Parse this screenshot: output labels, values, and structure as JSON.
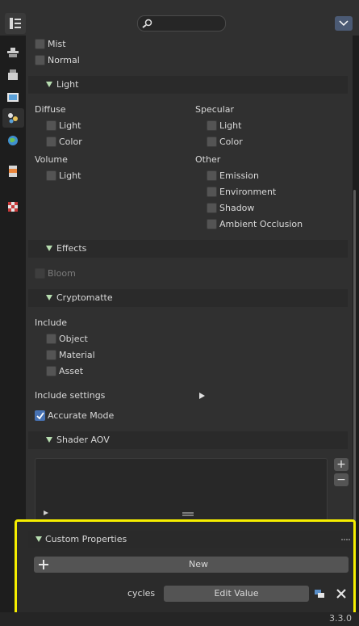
{
  "app": {
    "version": "3.3.0"
  },
  "search": {
    "placeholder": ""
  },
  "passes": {
    "mist": "Mist",
    "normal": "Normal"
  },
  "light": {
    "header": "Light",
    "diffuse": {
      "title": "Diffuse",
      "light": "Light",
      "color": "Color"
    },
    "specular": {
      "title": "Specular",
      "light": "Light",
      "color": "Color"
    },
    "volume": {
      "title": "Volume",
      "light": "Light"
    },
    "other": {
      "title": "Other",
      "emission": "Emission",
      "environment": "Environment",
      "shadow": "Shadow",
      "ambient_occlusion": "Ambient Occlusion"
    }
  },
  "effects": {
    "header": "Effects",
    "bloom": "Bloom"
  },
  "cryptomatte": {
    "header": "Cryptomatte",
    "include": "Include",
    "object": "Object",
    "material": "Material",
    "asset": "Asset",
    "include_settings": "Include settings",
    "accurate_mode": "Accurate Mode",
    "accurate_mode_checked": true
  },
  "shader_aov": {
    "header": "Shader AOV",
    "add": "+",
    "remove": "−"
  },
  "custom_properties": {
    "header": "Custom Properties",
    "new_button": "New",
    "prop_name": "cycles",
    "edit_value": "Edit Value"
  },
  "icons": [
    "editor-type-icon",
    "search-icon",
    "options-chevron-icon",
    "tool-icon",
    "render-icon",
    "output-icon",
    "view-layer-icon",
    "scene-icon",
    "world-icon",
    "object-data-icon",
    "texture-icon",
    "python-icon",
    "close-icon"
  ]
}
